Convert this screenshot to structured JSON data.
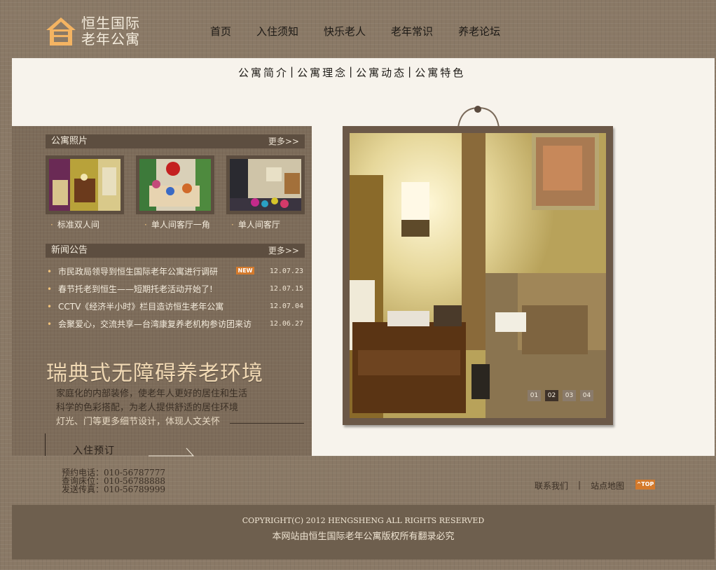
{
  "brand": {
    "line1": "恒生国际",
    "line2": "老年公寓",
    "accent": "#f4b462"
  },
  "nav": {
    "items": [
      {
        "label": "首页"
      },
      {
        "label": "入住须知"
      },
      {
        "label": "快乐老人"
      },
      {
        "label": "老年常识"
      },
      {
        "label": "养老论坛"
      }
    ]
  },
  "subnav": {
    "items": [
      {
        "label": "公寓简介"
      },
      {
        "label": "公寓理念"
      },
      {
        "label": "公寓动态"
      },
      {
        "label": "公寓特色"
      }
    ],
    "separator": "|"
  },
  "photos": {
    "title": "公寓照片",
    "more": "更多>>",
    "items": [
      {
        "caption": "标准双人间"
      },
      {
        "caption": "单人间客厅一角"
      },
      {
        "caption": "单人间客厅"
      }
    ]
  },
  "news": {
    "title": "新闻公告",
    "more": "更多>>",
    "badge": "NEW",
    "items": [
      {
        "title": "市民政局领导到恒生国际老年公寓进行调研",
        "date": "12.07.23"
      },
      {
        "title": "春节托老到恒生——短期托老活动开始了!",
        "date": "12.07.15"
      },
      {
        "title": "CCTV《经济半小时》栏目造访恒生老年公寓",
        "date": "12.07.04"
      },
      {
        "title": "会聚爱心，交流共享—台湾康复养老机构参访团来访",
        "date": "12.06.27"
      }
    ]
  },
  "promo": {
    "title": "瑞典式无障碍养老环境",
    "line1": "家庭化的内部装修，使老年人更好的居住和生活",
    "line2": "科学的色彩搭配，为老人提供舒适的居住环境",
    "line3": "灯光、门等更多细节设计，体现人文关怀"
  },
  "booking": {
    "label": "入住预订"
  },
  "contacts": {
    "phone": "预约电话：010-56787777",
    "beds": "查询床位：010-56788888",
    "fax": "发送传真：010-56789999"
  },
  "slideshow": {
    "dots": [
      "01",
      "02",
      "03",
      "04"
    ],
    "active": 1
  },
  "footer": {
    "contact_us": "联系我们",
    "sep": "|",
    "sitemap": "站点地图",
    "top": "^TOP",
    "copyright": "COPYRIGHT(C) 2012 HENGSHENG  ALL RIGHTS RESERVED",
    "copyright2": "本网站由恒生国际老年公寓版权所有翻录必究"
  }
}
